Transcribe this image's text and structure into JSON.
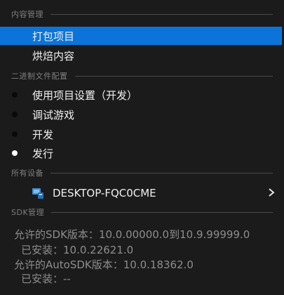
{
  "content_management": {
    "header": "内容管理",
    "items": [
      {
        "label": "打包项目"
      },
      {
        "label": "烘焙内容"
      }
    ]
  },
  "binary_config": {
    "header": "二进制文件配置",
    "items": [
      {
        "label": "使用项目设置（开发）"
      },
      {
        "label": "调试游戏"
      },
      {
        "label": "开发"
      },
      {
        "label": "发行"
      }
    ]
  },
  "all_devices": {
    "header": "所有设备",
    "device": {
      "name": "DESKTOP-FQC0CME",
      "icon": "windows-desktop-icon"
    }
  },
  "sdk_management": {
    "header": "SDK管理",
    "lines": [
      "允许的SDK版本：10.0.00000.0到10.9.99999.0",
      "已安装：10.0.22621.0",
      "允许的AutoSDK版本：10.0.18362.0",
      "已安装：--"
    ]
  },
  "colors": {
    "selection": "#0c74d8",
    "background": "#1b1b1b",
    "header_text": "#7f7f7f",
    "info_text": "#8d8d8d"
  }
}
